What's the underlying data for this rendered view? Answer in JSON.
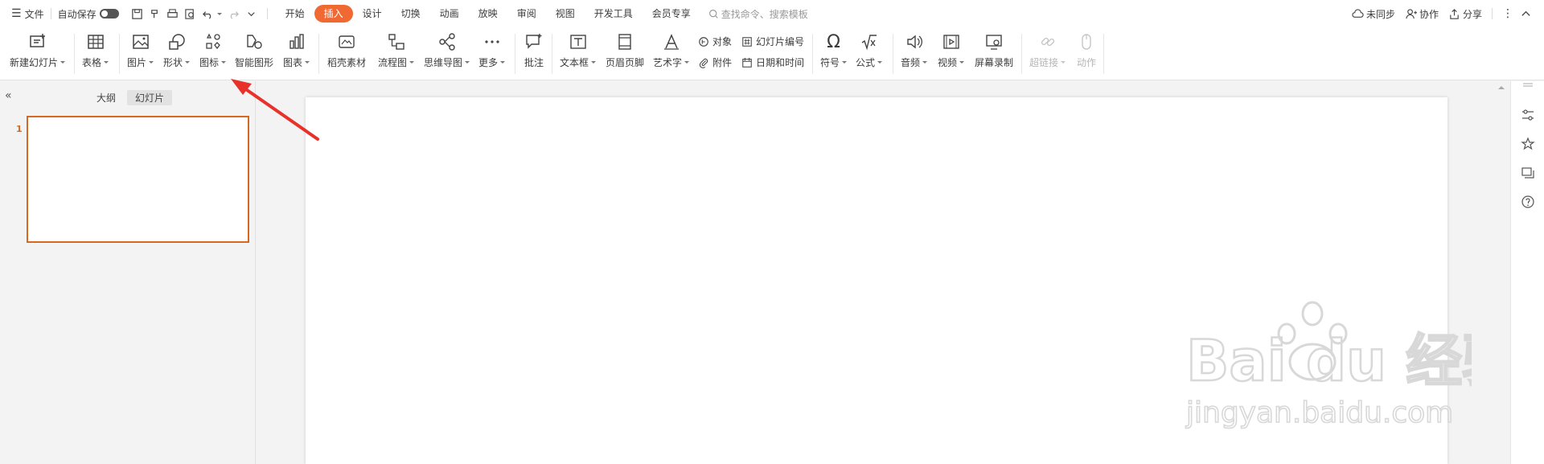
{
  "menubar": {
    "file_label": "文件",
    "autosave_label": "自动保存",
    "tabs": [
      {
        "label": "开始",
        "active": false
      },
      {
        "label": "插入",
        "active": true
      },
      {
        "label": "设计",
        "active": false
      },
      {
        "label": "切换",
        "active": false
      },
      {
        "label": "动画",
        "active": false
      },
      {
        "label": "放映",
        "active": false
      },
      {
        "label": "审阅",
        "active": false
      },
      {
        "label": "视图",
        "active": false
      },
      {
        "label": "开发工具",
        "active": false
      },
      {
        "label": "会员专享",
        "active": false
      }
    ],
    "search_placeholder": "查找命令、搜索模板",
    "sync_label": "未同步",
    "collab_label": "协作",
    "share_label": "分享",
    "accent_color": "#f06933"
  },
  "ribbon": {
    "new_slide": "新建幻灯片",
    "table": "表格",
    "picture": "图片",
    "shape": "形状",
    "icon": "图标",
    "smart_graphic": "智能图形",
    "chart": "图表",
    "daoke_material": "稻壳素材",
    "flowchart": "流程图",
    "mindmap": "思维导图",
    "more": "更多",
    "comment": "批注",
    "textbox": "文本框",
    "header_footer": "页眉页脚",
    "wordart": "艺术字",
    "object": "对象",
    "attachment": "附件",
    "slide_number": "幻灯片编号",
    "date_time": "日期和时间",
    "symbol": "符号",
    "formula": "公式",
    "audio": "音频",
    "video": "视频",
    "screen_record": "屏幕录制",
    "hyperlink": "超链接",
    "action": "动作"
  },
  "left_panel": {
    "tabs": [
      {
        "label": "大纲",
        "active": false
      },
      {
        "label": "幻灯片",
        "active": true
      }
    ],
    "slide_number": "1",
    "selection_color": "#d4691f"
  },
  "watermark": {
    "brand": "Bai du 经验",
    "url": "jingyan.baidu.com"
  }
}
